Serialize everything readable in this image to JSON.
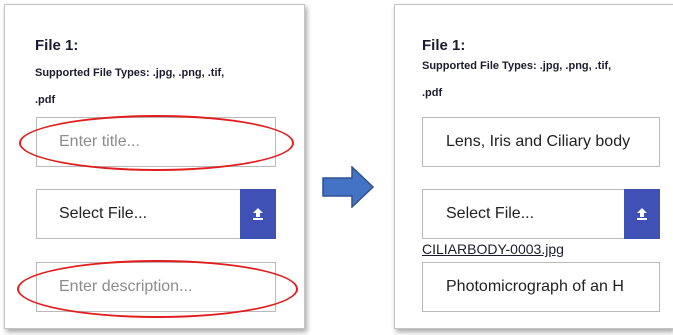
{
  "left_panel": {
    "heading": "File 1:",
    "types_line1": "Supported File Types: .jpg, .png, .tif,",
    "types_line2": ".pdf",
    "title_placeholder": "Enter title...",
    "select_label": "Select File...",
    "description_placeholder": "Enter description..."
  },
  "right_panel": {
    "heading": "File 1:",
    "types_line1": "Supported File Types: .jpg, .png, .tif,",
    "types_line2": ".pdf",
    "title_value": "Lens, Iris and Ciliary body",
    "select_label": "Select File...",
    "file_name": "CILIARBODY-0003.jpg",
    "description_value": "Photomicrograph of an H"
  },
  "icons": {
    "upload": "upload-icon",
    "arrow": "right-arrow-icon"
  },
  "colors": {
    "accent_button": "#3f51b5",
    "highlight_circle": "#e11d1d",
    "arrow_fill": "#4472c4"
  }
}
